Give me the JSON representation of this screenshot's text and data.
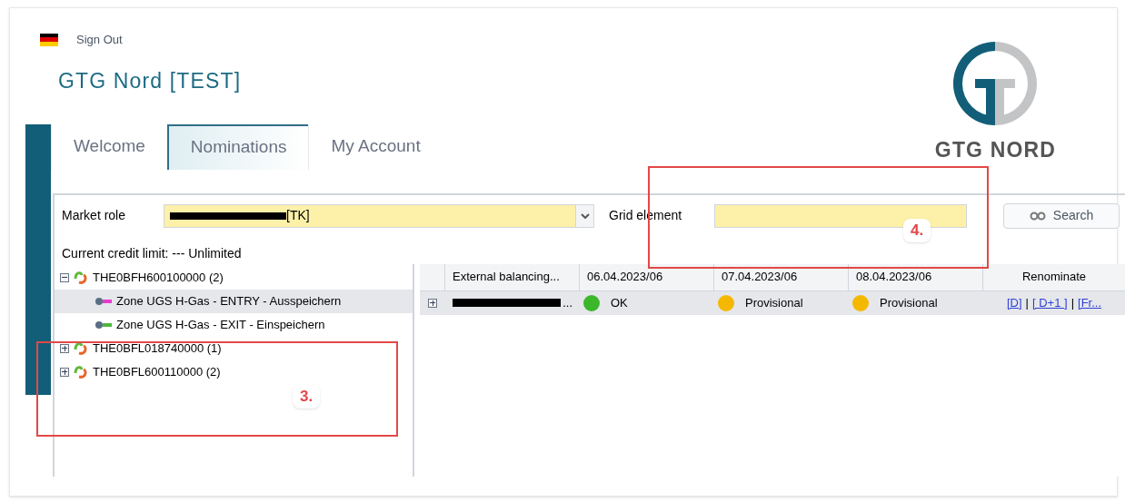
{
  "header": {
    "sign_out": "Sign Out",
    "title": "GTG Nord [TEST]",
    "logo_text": "GTG NORD"
  },
  "tabs": [
    {
      "label": "Welcome",
      "selected": false
    },
    {
      "label": "Nominations",
      "selected": true
    },
    {
      "label": "My Account",
      "selected": false
    }
  ],
  "filters": {
    "market_role_label": "Market role",
    "market_role_value": "[TK]",
    "grid_element_label": "Grid element",
    "search_button": "Search"
  },
  "link_separator": "|",
  "credit_limit": "Current credit limit: --- Unlimited",
  "tree": [
    {
      "label": "THE0BFH600100000 (2)",
      "expanded": true,
      "selected": false,
      "children": [
        {
          "label": "Zone UGS H-Gas - ENTRY - Ausspeichern",
          "kind": "entry",
          "selected": true
        },
        {
          "label": "Zone UGS H-Gas - EXIT - Einspeichern",
          "kind": "exit",
          "selected": false
        }
      ]
    },
    {
      "label": "THE0BFL018740000 (1)",
      "expanded": false,
      "selected": false
    },
    {
      "label": "THE0BFL600110000 (2)",
      "expanded": false,
      "selected": false
    }
  ],
  "table": {
    "columns": [
      "External balancing...",
      "06.04.2023/06",
      "07.04.2023/06",
      "08.04.2023/06",
      "Renominate"
    ],
    "rows": [
      {
        "expanded": false,
        "col1_suffix": "...",
        "statuses": [
          {
            "label": "OK",
            "color": "#3cb72c"
          },
          {
            "label": "Provisional",
            "color": "#f5b800"
          },
          {
            "label": "Provisional",
            "color": "#f5b800"
          }
        ],
        "links": [
          "[D]",
          "[ D+1 ]",
          "[Fr..."
        ]
      }
    ]
  },
  "annotations": [
    {
      "label": "3."
    },
    {
      "label": "4."
    }
  ]
}
